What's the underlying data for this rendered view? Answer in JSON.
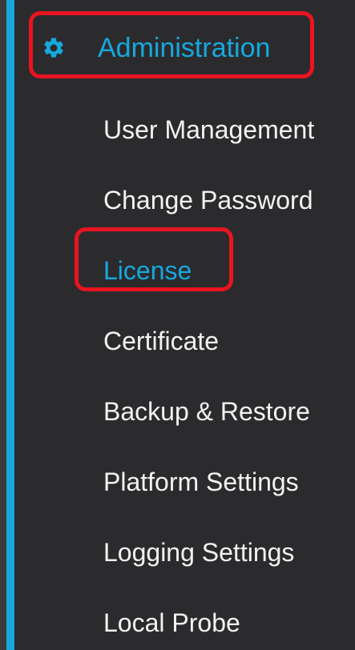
{
  "section": {
    "title": "Administration",
    "icon": "gear-icon"
  },
  "menu": {
    "items": [
      {
        "label": "User Management",
        "active": false
      },
      {
        "label": "Change Password",
        "active": false
      },
      {
        "label": "License",
        "active": true
      },
      {
        "label": "Certificate",
        "active": false
      },
      {
        "label": "Backup & Restore",
        "active": false
      },
      {
        "label": "Platform Settings",
        "active": false
      },
      {
        "label": "Logging Settings",
        "active": false
      },
      {
        "label": "Local Probe",
        "active": false
      }
    ]
  },
  "colors": {
    "accent": "#16a9dc",
    "background": "#2b2b2e",
    "text": "#f2f2f2",
    "highlight": "#e8141f"
  }
}
